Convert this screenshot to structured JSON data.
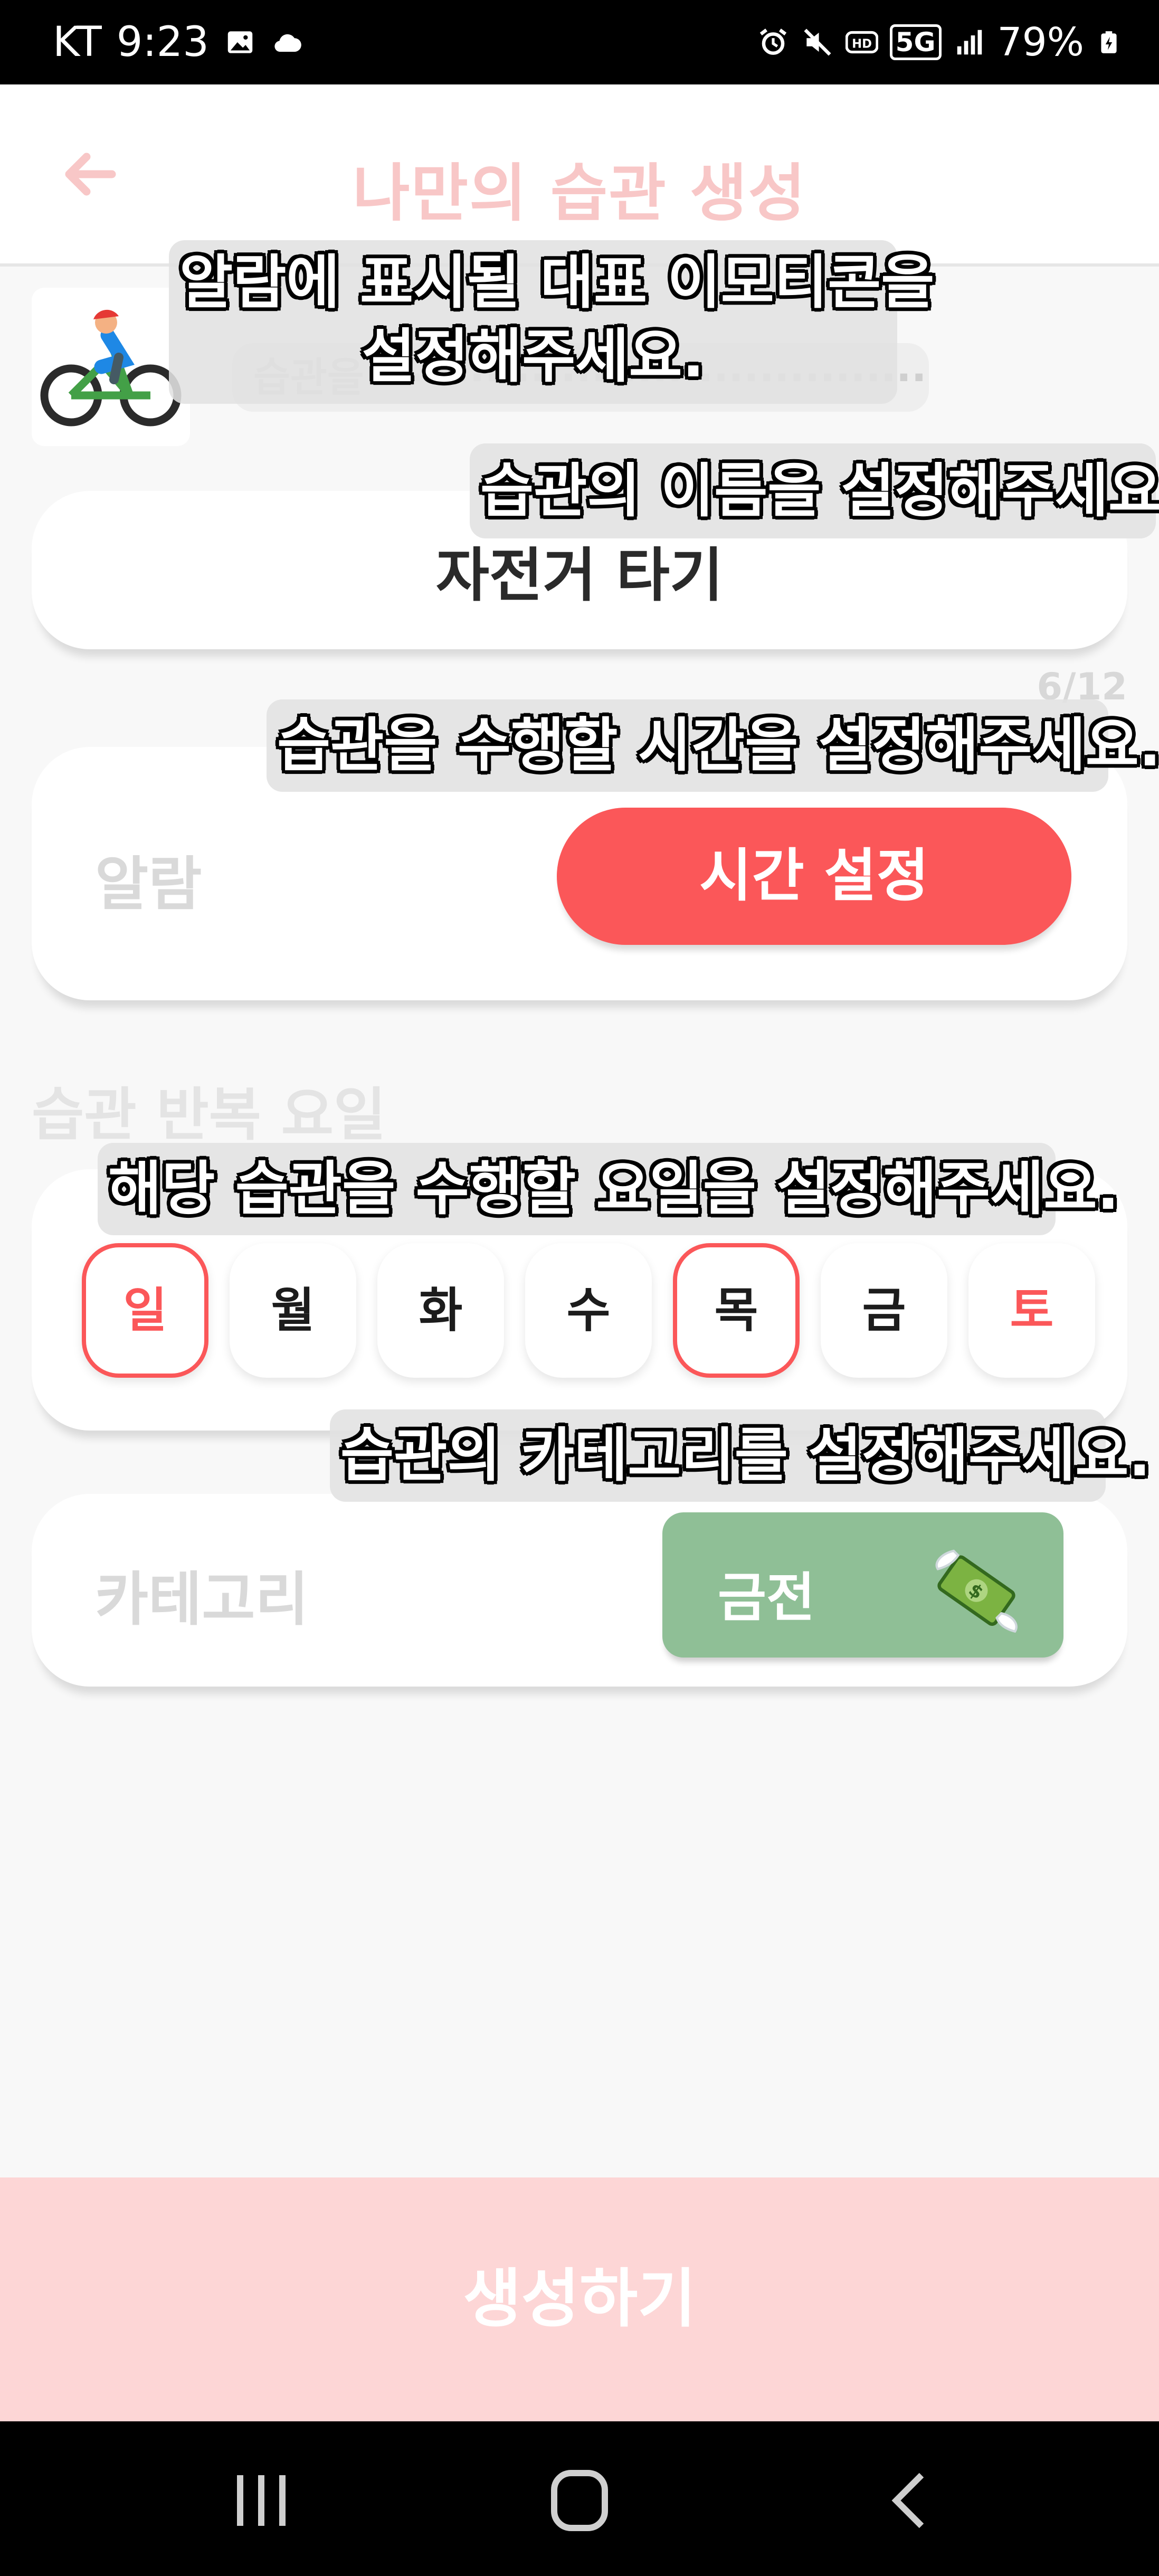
{
  "status_bar": {
    "carrier": "KT",
    "time": "9:23",
    "network": "5G",
    "battery": "79%",
    "icons": [
      "image-icon",
      "cloud-icon",
      "alarm-icon",
      "mute-icon",
      "hd-icon",
      "5g-icon",
      "signal-icon",
      "battery-icon"
    ]
  },
  "app_bar": {
    "title": "나만의 습관 생성",
    "back_icon": "back-arrow-icon"
  },
  "emoji": {
    "icon": "person-biking-emoji"
  },
  "name_field": {
    "value": "자전거 타기",
    "counter": "6/12"
  },
  "alarm": {
    "label": "알람",
    "button_label": "시간 설정"
  },
  "days": {
    "heading": "습관 반복 요일",
    "items": [
      {
        "label": "일",
        "selected": true
      },
      {
        "label": "월",
        "selected": false
      },
      {
        "label": "화",
        "selected": false
      },
      {
        "label": "수",
        "selected": false
      },
      {
        "label": "목",
        "selected": true
      },
      {
        "label": "금",
        "selected": false
      },
      {
        "label": "토",
        "selected": false
      }
    ]
  },
  "category": {
    "label": "카테고리",
    "selected": "금전",
    "icon": "money-with-wings-icon"
  },
  "create_button": "생성하기",
  "overlays": {
    "emoji_line1": "알람에 표시될 대표 이모티콘을",
    "emoji_line2": "설정해주세요.",
    "name": "습관의 이름을 설정해주세요.",
    "time": "습관을 수행할 시간을 설정해주세요.",
    "days": "해당 습관을 수행할 요일을 설정해주세요.",
    "category": "습관의 카테고리를 설정해주세요."
  },
  "nav_bar": [
    "recents-icon",
    "home-icon",
    "back-icon"
  ],
  "colors": {
    "accent": "#fb5759",
    "title_pink": "#f8c7c7",
    "create_button_bg": "#fdd6d6",
    "category_chip": "#8fbf96"
  }
}
